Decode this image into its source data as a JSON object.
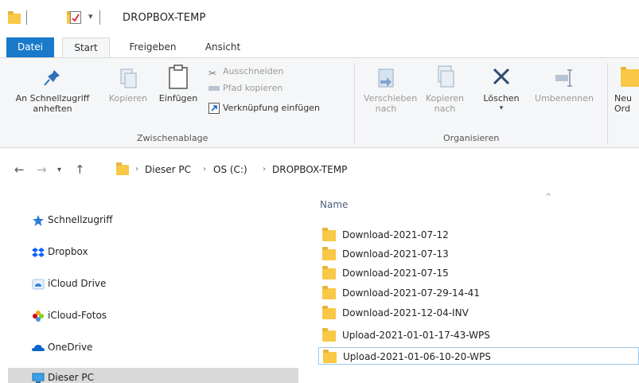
{
  "window": {
    "title": "DROPBOX-TEMP"
  },
  "tabs": [
    {
      "label": "Datei"
    },
    {
      "label": "Start"
    },
    {
      "label": "Freigeben"
    },
    {
      "label": "Ansicht"
    }
  ],
  "ribbon": {
    "pin_label": "An Schnellzugriff anheften",
    "copy_label": "Kopieren",
    "paste_label": "Einfügen",
    "cut_label": "Ausschneiden",
    "copy_path_label": "Pfad kopieren",
    "paste_shortcut_label": "Verknüpfung einfügen",
    "clipboard_group": "Zwischenablage",
    "move_to_label": "Verschieben nach",
    "copy_to_label": "Kopieren nach",
    "delete_label": "Löschen",
    "rename_label": "Umbenennen",
    "organize_group": "Organisieren",
    "new_folder_label": "Neu Ord"
  },
  "address": {
    "crumbs": [
      "Dieser PC",
      "OS (C:)",
      "DROPBOX-TEMP"
    ]
  },
  "navpane": {
    "items": [
      {
        "label": "Schnellzugriff"
      },
      {
        "label": "Dropbox"
      },
      {
        "label": "iCloud Drive"
      },
      {
        "label": "iCloud-Fotos"
      },
      {
        "label": "OneDrive"
      },
      {
        "label": "Dieser PC"
      }
    ]
  },
  "filelist": {
    "column_name": "Name",
    "rows": [
      {
        "name": "Download-2021-07-12"
      },
      {
        "name": "Download-2021-07-13"
      },
      {
        "name": "Download-2021-07-15"
      },
      {
        "name": "Download-2021-07-29-14-41"
      },
      {
        "name": "Download-2021-12-04-INV"
      },
      {
        "name": "Upload-2021-01-01-17-43-WPS"
      },
      {
        "name": "Upload-2021-01-06-10-20-WPS"
      }
    ]
  },
  "colors": {
    "accent": "#1979ca",
    "folder": "#f8c846",
    "selection": "#d9d9d9"
  }
}
